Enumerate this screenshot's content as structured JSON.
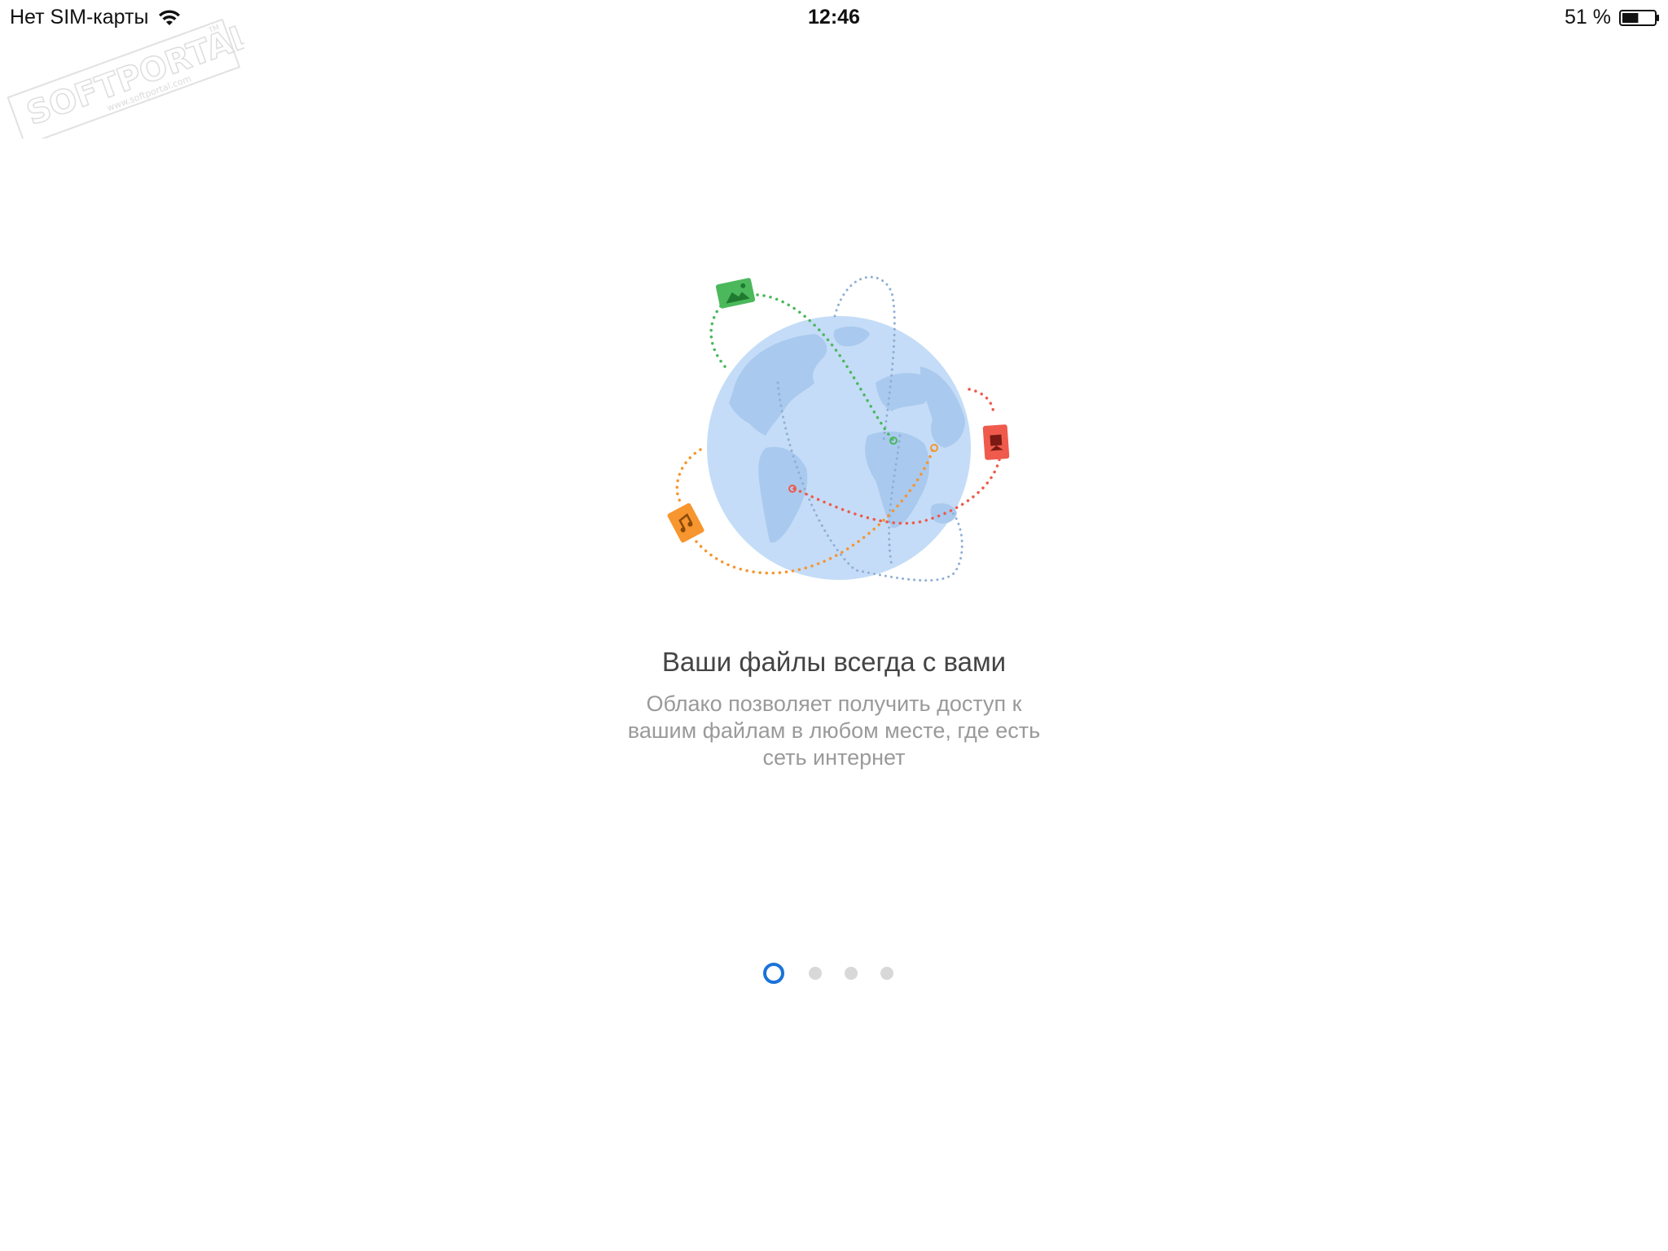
{
  "status_bar": {
    "carrier": "Нет SIM-карты",
    "wifi_icon": "wifi-icon",
    "time": "12:46",
    "battery_percent": "51 %",
    "battery_icon": "battery-icon",
    "battery_level": 0.51
  },
  "watermark": {
    "brand": "SOFTPORTAL",
    "url": "www.softportal.com",
    "tm": "TM"
  },
  "onboarding": {
    "title": "Ваши файлы всегда с вами",
    "description_lines": [
      "Облако позволяет получить доступ к",
      "вашим файлам в любом месте, где есть",
      "сеть интернет"
    ],
    "illustration": {
      "globe_icon": "globe-icon",
      "file_icons": [
        "image-file-icon",
        "video-file-icon",
        "music-file-icon"
      ],
      "colors": {
        "globe": "#c4dcf7",
        "continents": "#a9c9ee",
        "green": "#4cb85c",
        "red": "#ef5a4c",
        "orange": "#f7952e",
        "gray_blue": "#8fafd4"
      }
    }
  },
  "pager": {
    "total": 4,
    "current": 1,
    "active_color": "#1a73d8",
    "inactive_color": "#d8d8d8"
  }
}
